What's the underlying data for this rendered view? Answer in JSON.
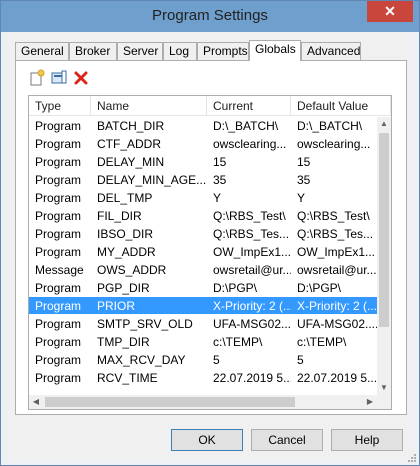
{
  "window": {
    "title": "Program Settings",
    "close_glyph": "✕"
  },
  "tabs": [
    {
      "label": "General"
    },
    {
      "label": "Broker"
    },
    {
      "label": "Server"
    },
    {
      "label": "Log"
    },
    {
      "label": "Prompts"
    },
    {
      "label": "Globals",
      "active": true
    },
    {
      "label": "Advanced"
    }
  ],
  "toolbar": {
    "icons": [
      "new-item-icon",
      "edit-item-icon",
      "delete-icon"
    ]
  },
  "table": {
    "columns": [
      "Type",
      "Name",
      "Current",
      "Default Value"
    ],
    "rows": [
      [
        "Program",
        "BATCH_DIR",
        "D:\\_BATCH\\",
        "D:\\_BATCH\\"
      ],
      [
        "Program",
        "CTF_ADDR",
        "owsclearing...",
        "owsclearing..."
      ],
      [
        "Program",
        "DELAY_MIN",
        "15",
        "15"
      ],
      [
        "Program",
        "DELAY_MIN_AGE...",
        "35",
        "35"
      ],
      [
        "Program",
        "DEL_TMP",
        "Y",
        "Y"
      ],
      [
        "Program",
        "FIL_DIR",
        "Q:\\RBS_Test\\",
        "Q:\\RBS_Test\\"
      ],
      [
        "Program",
        "IBSO_DIR",
        "Q:\\RBS_Tes...",
        "Q:\\RBS_Tes..."
      ],
      [
        "Program",
        "MY_ADDR",
        "OW_ImpEx1...",
        "OW_ImpEx1..."
      ],
      [
        "Message",
        "OWS_ADDR",
        "owsretail@ur...",
        "owsretail@ur..."
      ],
      [
        "Program",
        "PGP_DIR",
        "D:\\PGP\\",
        "D:\\PGP\\"
      ],
      [
        "Program",
        "PRIOR",
        "X-Priority: 2 (...",
        "X-Priority: 2 (..."
      ],
      [
        "Program",
        "SMTP_SRV_OLD",
        "UFA-MSG02....",
        "UFA-MSG02...."
      ],
      [
        "Program",
        "TMP_DIR",
        "c:\\TEMP\\",
        "c:\\TEMP\\"
      ],
      [
        "Program",
        "MAX_RCV_DAY",
        "5",
        "5"
      ],
      [
        "Program",
        "RCV_TIME",
        "22.07.2019 5...",
        "22.07.2019 5..."
      ]
    ],
    "selected_row": 10
  },
  "buttons": {
    "ok": "OK",
    "cancel": "Cancel",
    "help": "Help"
  },
  "colors": {
    "selection": "#3399ff",
    "title_bar": "#6f9fcc",
    "close": "#c9463d"
  }
}
